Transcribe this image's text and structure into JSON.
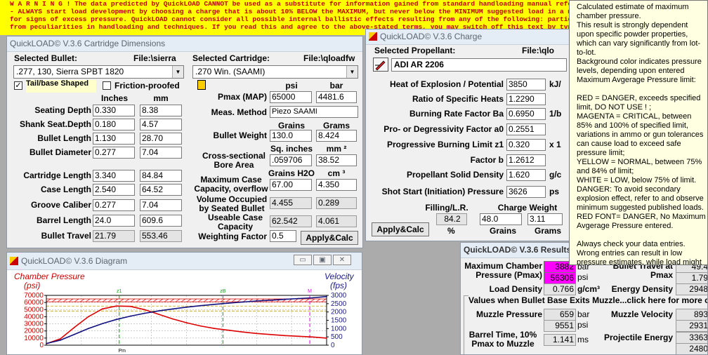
{
  "warning": {
    "line1": "W A R N I N G ! The data predicted by QuickLOAD CANNOT be used as a substitute for information gained from standard handloading manual references; further, it",
    "line2": "- ALWAYS start load development by choosing a charge that is about 10% BELOW the MAXIMUM, but never below the MINIMUM suggested load in a modern data",
    "line3": "for signs of excess pressure. QuickLOAD cannot consider all possible internal ballistic effects resulting from any of the following: particular gun vagaries; or pro",
    "line4": "from peculiarities in handloading and techniques. If you read this and agree to the above-stated terms, you may switch off this text by typing the words I AGREE in"
  },
  "cartridge_window": {
    "title": "QuickLOAD© V.3.6 Cartridge Dimensions",
    "selected_bullet_label": "Selected Bullet:",
    "bullet_file_label": "File:\\sierra",
    "bullet_value": ".277, 130, Sierra SPBT 1820",
    "tailbase_label": "Tail/base Shaped",
    "friction_label": "Friction-proofed",
    "col_inches": "Inches",
    "col_mm": "mm",
    "rows": [
      {
        "label": "Seating Depth",
        "in": "0.330",
        "mm": "8.38"
      },
      {
        "label": "Shank Seat.Depth",
        "in": "0.180",
        "mm": "4.57"
      },
      {
        "label": "Bullet Length",
        "in": "1.130",
        "mm": "28.70"
      },
      {
        "label": "Bullet Diameter",
        "in": "0.277",
        "mm": "7.04"
      },
      {
        "label": "Cartridge Length",
        "in": "3.340",
        "mm": "84.84"
      },
      {
        "label": "Case Length",
        "in": "2.540",
        "mm": "64.52"
      },
      {
        "label": "Groove Caliber",
        "in": "0.277",
        "mm": "7.04"
      },
      {
        "label": "Barrel Length",
        "in": "24.0",
        "mm": "609.6"
      },
      {
        "label": "Bullet Travel",
        "in": "21.79",
        "mm": "553.46"
      }
    ],
    "selected_cartridge_label": "Selected Cartridge:",
    "cartridge_file_label": "File:\\qloadfw",
    "cartridge_value": ".270 Win. (SAAMI)",
    "col_psi": "psi",
    "col_bar": "bar",
    "pmax_label": "Pmax (MAP)",
    "pmax_psi": "65000",
    "pmax_bar": "4481.6",
    "meas_method_label": "Meas. Method",
    "meas_method": "Piezo SAAMI",
    "col_grains": "Grains",
    "col_grams": "Grams",
    "bullet_weight_label": "Bullet Weight",
    "bullet_weight_gr": "130.0",
    "bullet_weight_g": "8.424",
    "col_sqin": "Sq. inches",
    "col_mm2": "mm ²",
    "bore_area_label": "Cross-sectional Bore Area",
    "bore_area_in": ".059706",
    "bore_area_mm": "38.52",
    "col_grh2o": "Grains H2O",
    "col_cm3": "cm ³",
    "max_case_label": "Maximum Case Capacity, overflow",
    "max_case_gr": "67.00",
    "max_case_cm": "4.350",
    "vol_seated_label": "Volume Occupied by Seated Bullet",
    "vol_seated_gr": "4.455",
    "vol_seated_cm": "0.289",
    "useable_label": "Useable Case Capacity",
    "useable_gr": "62.542",
    "useable_cm": "4.061",
    "weighting_label": "Weighting Factor",
    "weighting_value": "0.5",
    "apply_label": "Apply&Calc"
  },
  "charge_window": {
    "title": "QuickLOAD© V.3.6 Charge",
    "selected_propellant_label": "Selected Propellant:",
    "propellant_file_label": "File:\\qlo",
    "propellant_value": "ADI AR 2206",
    "rows": [
      {
        "label": "Heat of Explosion / Potential",
        "value": "3850",
        "unit": "kJ/"
      },
      {
        "label": "Ratio of Specific Heats",
        "value": "1.2290",
        "unit": ""
      },
      {
        "label": "Burning Rate Factor  Ba",
        "value": "0.6950",
        "unit": "1/b"
      },
      {
        "label": "Pro- or Degressivity Factor  a0",
        "value": "0.2551",
        "unit": ""
      },
      {
        "label": "Progressive Burning Limit z1",
        "value": "0.320",
        "unit": "x 1"
      },
      {
        "label": "Factor  b",
        "value": "1.2612",
        "unit": ""
      },
      {
        "label": "Propellant Solid Density",
        "value": "1.620",
        "unit": "g/c"
      },
      {
        "label": "Shot Start (Initiation) Pressure",
        "value": "3626",
        "unit": "ps"
      }
    ],
    "filling_label": "Filling/L.R.",
    "charge_weight_label": "Charge Weight",
    "filling_value": "84.2",
    "grains_value": "48.0",
    "grams_value": "3.11",
    "pct_label": "%",
    "grains_label": "Grains",
    "grams_label": "Grams",
    "apply_label": "Apply&Calc"
  },
  "diagram_window": {
    "title": "QuickLOAD© V.3.6 Diagram",
    "chamber_pressure_label": "Chamber Pressure",
    "psi_label": "(psi)",
    "velocity_label": "Velocity",
    "fps_label": "(fps)",
    "marker_z1": "z1",
    "marker_zb": "zB",
    "marker_pm": "Pm",
    "marker_m": "M"
  },
  "chart_data": {
    "type": "line",
    "y_ticks": [
      "70000",
      "60000",
      "50000",
      "40000",
      "30000",
      "20000",
      "10000",
      "0"
    ],
    "ylim": [
      0,
      70000
    ],
    "y2_ticks": [
      "3000",
      "2500",
      "2000",
      "1500",
      "1000",
      "500",
      "0"
    ],
    "y2lim": [
      0,
      3000
    ],
    "x": [
      0,
      0.05,
      0.1,
      0.15,
      0.2,
      0.25,
      0.3,
      0.35,
      0.4,
      0.45,
      0.5,
      0.55,
      0.6,
      0.65,
      0.7,
      0.75,
      0.8,
      0.85,
      0.9,
      0.95,
      1.0
    ],
    "series": [
      {
        "values": [
          2000,
          9000,
          25000,
          40000,
          51000,
          55000,
          54500,
          50000,
          43500,
          37000,
          31500,
          27000,
          23500,
          21000,
          18500,
          16500,
          15000,
          13500,
          12500,
          11500,
          10000
        ]
      },
      {
        "values": [
          100,
          300,
          650,
          1000,
          1300,
          1550,
          1750,
          1920,
          2060,
          2180,
          2290,
          2380,
          2460,
          2530,
          2600,
          2660,
          2710,
          2760,
          2810,
          2850,
          2930
        ]
      }
    ],
    "colors": {
      "pressure": "#dd0000",
      "velocity": "#101080",
      "limit": "#dd0000",
      "grid": "#b0b0b0"
    }
  },
  "results_window": {
    "title": "QuickLOAD© V.3.6 Results",
    "max_pressure_label": "Maximum Chamber Pressure (Pmax)",
    "max_pressure_bar": "3882",
    "bar_unit": "bar",
    "max_pressure_psi": "56306",
    "psi_unit": "psi",
    "travel_label": "Bullet Travel at Pmax",
    "travel_value1": "49.4",
    "travel_value2": "1.79",
    "load_density_label": "Load Density",
    "load_density": "0.766",
    "load_density_unit": "g/cm³",
    "energy_density_label": "Energy Density",
    "energy_density": "2948",
    "section_label": "Values when Bullet Base Exits Muzzle...click here for more o",
    "muzzle_pressure_label": "Muzzle Pressure",
    "muzzle_pressure_bar": "659",
    "muzzle_pressure_psi": "9551",
    "muzzle_velocity_label": "Muzzle Velocity",
    "muzzle_velocity1": "893",
    "muzzle_velocity2": "2931",
    "barrel_time_label": "Barrel Time, 10% Pmax to Muzzle",
    "barrel_time": "1.141",
    "ms_unit": "ms",
    "projectile_energy_label": "Projectile Energy",
    "projectile_energy1": "3363",
    "projectile_energy2": "2480"
  },
  "tooltip": {
    "p1": "Calculated estimate of maximum chamber pressure.",
    "p2": "This result is strongly dependent upon specific powder properties, which can vary significantly from lot-to-lot.",
    "p3": "Background color indicates pressure levels, depending upon entered Maximum Avgerage Pressure limit:",
    "p4": "RED = DANGER, exceeds specified limit, DO NOT USE ! ;",
    "p5": "MAGENTA = CRITICAL, between 85% and 100% of specified limit, variations in ammo or gun tolerances can cause load to exceed safe pressure limit;",
    "p6": "YELLOW = NORMAL, between 75% and 84% of limit;",
    "p7": "WHITE = LOW, below 75% of limit.",
    "p8": "DANGER: To avoid secondary explosion effect, refer to and observe minimum suggested published loads.",
    "p9": "RED FONT= DANGER, No Maximum Avgerage Pressure entered.",
    "p10": "Always check your data entries. Wrong entries can result in low pressure estimates, while load might actually produce excessive pressure."
  }
}
